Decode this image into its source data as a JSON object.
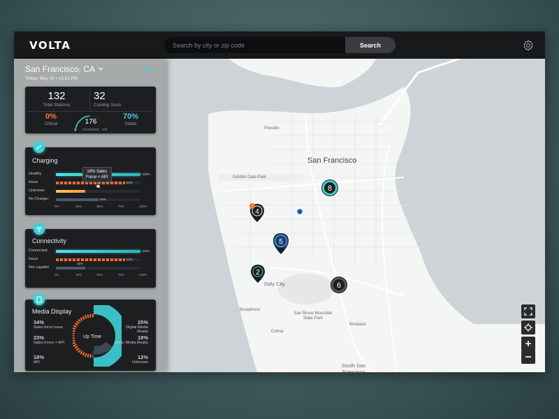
{
  "app": {
    "logo": "VOLTA"
  },
  "search": {
    "placeholder": "Search by city or zip code",
    "button": "Search"
  },
  "sidebar": {
    "city": "San Francisco, CA",
    "date": "Today, May 18 • 12:21 PM",
    "stats": {
      "total_stations": {
        "value": "132",
        "label": "Total Stations"
      },
      "coming_soon": {
        "value": "32",
        "label": "Coming Soon"
      },
      "critical": {
        "value": "0%",
        "label": "Critical"
      },
      "stable": {
        "value": "70%",
        "label": "Stable"
      },
      "gauge": {
        "value": "176",
        "label": "CHARGING",
        "min": "0",
        "max": "370",
        "fraction": 0.476
      }
    },
    "charging": {
      "title": "Charging",
      "rows": [
        {
          "label": "Healthy",
          "value": 100,
          "value_label": "100%"
        },
        {
          "label": "Issue",
          "value": 82,
          "value_label": "82%"
        },
        {
          "label": "Unknown",
          "value": 35
        },
        {
          "label": "No Charger",
          "value": 50,
          "value_label": "50%"
        }
      ],
      "tooltip": [
        "18% Sales",
        "Force + API"
      ],
      "axis": [
        "0%",
        "25%",
        "50%",
        "75%",
        "100%"
      ]
    },
    "connectivity": {
      "title": "Connectivity",
      "rows": [
        {
          "label": "Connected",
          "value": 100,
          "value_label": "100%"
        },
        {
          "label": "Issue",
          "value": 82,
          "value_label": "82%"
        },
        {
          "label": "Not capable",
          "value": 35,
          "value_label": "35%"
        }
      ],
      "axis": [
        "0%",
        "25%",
        "50%",
        "75%",
        "100%"
      ]
    },
    "media": {
      "title": "Media Display",
      "center_label": "Up Time",
      "left": [
        {
          "pct": "34%",
          "label": "Sales force Issue"
        },
        {
          "pct": "23%",
          "label": "Sales Force + API"
        },
        {
          "pct": "18%",
          "label": "API"
        }
      ],
      "right": [
        {
          "pct": "25%",
          "label": "Digital Media Ready"
        },
        {
          "pct": "18%",
          "label": "Static Media Ready"
        },
        {
          "pct": "12%",
          "label": "Unknown"
        }
      ]
    }
  },
  "map": {
    "labels": {
      "sf": "San Francisco",
      "presidio": "Presidio",
      "ggpark": "Golden Gate Park",
      "daly": "Daly City",
      "broadmoor": "Broadmoor",
      "sanbruno": "San Bruno Mountain State Park",
      "colma": "Colma",
      "brisbane": "Brisbane",
      "ssf": "South San Francisco"
    },
    "markers": [
      {
        "count": "8",
        "style": "cyan-ring"
      },
      {
        "count": "4",
        "style": "pin-dark",
        "alert": "1"
      },
      {
        "count": "5",
        "style": "pin-blue"
      },
      {
        "count": "2",
        "style": "pin-dark"
      },
      {
        "count": "6",
        "style": "dark-ring"
      }
    ]
  },
  "colors": {
    "accent": "#3fd0d8",
    "issue": "#ff6a2a",
    "unknown": "#ffcc55",
    "none": "#4a5a6a",
    "critical": "#ff7a3a",
    "stable": "#3fd0d8"
  },
  "icons": [
    "settings-gear-icon",
    "back-arrow-icon",
    "chevron-down-icon",
    "charging-plug-icon",
    "wifi-icon",
    "media-display-icon",
    "fullscreen-icon",
    "locate-icon",
    "zoom-in-icon",
    "zoom-out-icon"
  ]
}
